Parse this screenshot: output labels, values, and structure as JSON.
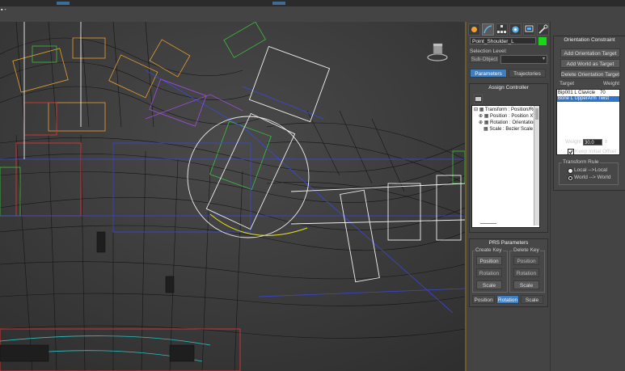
{
  "viewport": {
    "menu_label": "▪ -"
  },
  "command_panel": {
    "object_name": "Point_Shoulder_L",
    "object_color": "#19d619",
    "selection_level_label": "Selection Level:",
    "sub_object_label": "Sub-Object",
    "tabs": {
      "parameters": "Parameters",
      "trajectories": "Trajectories"
    },
    "assign_controller": {
      "title": "Assign Controller",
      "tree": [
        "Transform : Position/Rot",
        "Position : Position XYZ",
        "Rotation : Orientation",
        "Scale : Bezier Scale"
      ]
    },
    "prs": {
      "title": "PRS Parameters",
      "create_key_label": "Create Key",
      "delete_key_label": "Delete Key",
      "position": "Position",
      "rotation": "Rotation",
      "scale": "Scale",
      "bottom_tabs": [
        "Position",
        "Rotation",
        "Scale"
      ]
    }
  },
  "orientation_constraint": {
    "title": "Orientation Constraint",
    "add_target": "Add Orientation Target",
    "add_world": "Add World as Target",
    "delete_target": "Delete Orientation Target",
    "col_target": "Target",
    "col_weight": "Weight",
    "targets": [
      {
        "name": "Bip001 L Clavicle",
        "weight": "70"
      },
      {
        "name": "Bone L UpperArm Twist",
        "weight": ""
      }
    ],
    "weight_label": "Weight",
    "weight_value": "30.0",
    "keep_offset_label": "Keep Initial Offset",
    "transform_rule_label": "Transform Rule",
    "rule_local": "Local -->Local",
    "rule_world": "World --> World"
  }
}
